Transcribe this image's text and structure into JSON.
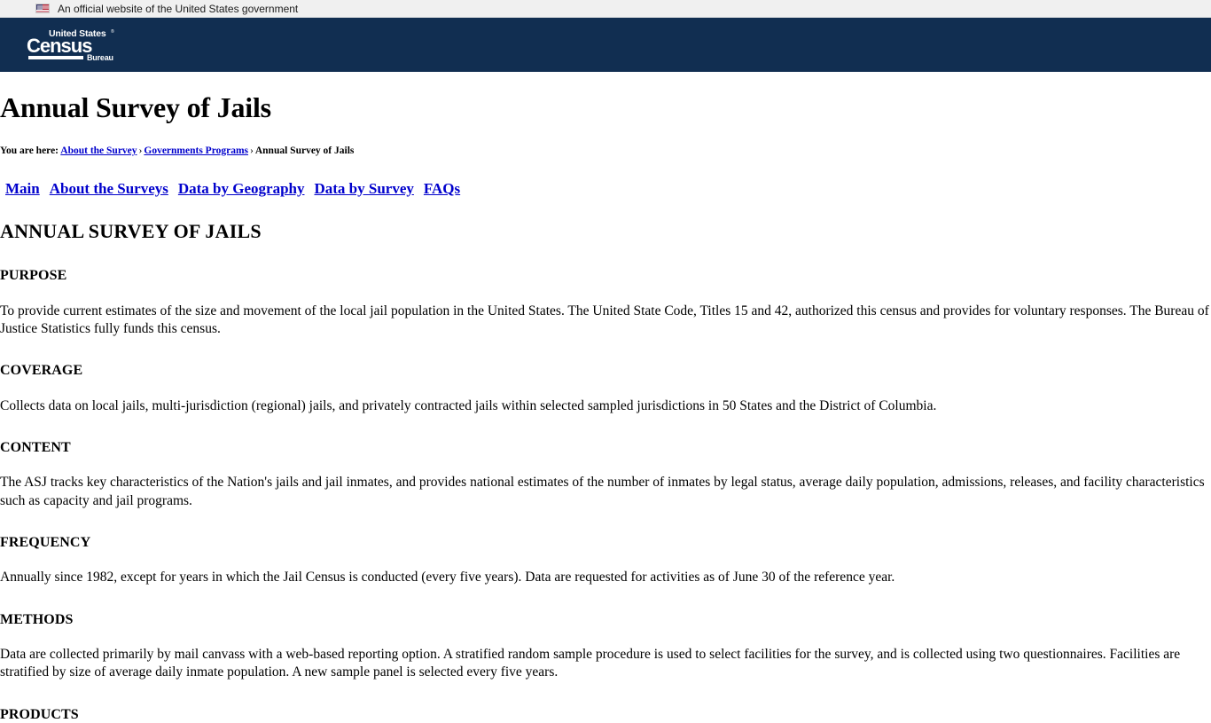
{
  "gov_banner": {
    "icon": "us-flag-icon",
    "text": "An official website of the United States government"
  },
  "header": {
    "logo": {
      "line1": "United States",
      "registered_mark": "®",
      "line2": "Census",
      "line3": "Bureau"
    },
    "background_color": "#112e51"
  },
  "page_title": "Annual Survey of Jails",
  "breadcrumb": {
    "prefix": "You are here:",
    "items": [
      {
        "label": "About the Survey",
        "is_link": true
      },
      {
        "label": "Governments Programs",
        "is_link": true
      },
      {
        "label": "Annual Survey of Jails",
        "is_link": false
      }
    ],
    "separator": "›"
  },
  "main_nav": {
    "items": [
      {
        "label": "Main"
      },
      {
        "label": "About the Surveys"
      },
      {
        "label": "Data by Geography"
      },
      {
        "label": "Data by Survey"
      },
      {
        "label": "FAQs"
      }
    ],
    "link_color": "#0000cc"
  },
  "content": {
    "heading": "ANNUAL SURVEY OF JAILS",
    "sections": [
      {
        "title": "PURPOSE",
        "text": "To provide current estimates of the size and movement of the local jail population in the United States. The United State Code, Titles 15 and 42, authorized this census and provides for voluntary responses. The Bureau of Justice Statistics fully funds this census."
      },
      {
        "title": "COVERAGE",
        "text": "Collects data on local jails, multi-jurisdiction (regional) jails, and privately contracted jails within selected sampled jurisdictions in 50 States and the District of Columbia."
      },
      {
        "title": "CONTENT",
        "text": "The ASJ tracks key characteristics of the Nation's jails and jail inmates, and provides national estimates of the number of inmates by legal status, average daily population, admissions, releases, and facility characteristics such as capacity and jail programs."
      },
      {
        "title": "FREQUENCY",
        "text": "Annually since 1982, except for years in which the Jail Census is conducted (every five years). Data are requested for activities as of June 30 of the reference year."
      },
      {
        "title": "METHODS",
        "text": "Data are collected primarily by mail canvass with a web-based reporting option. A stratified random sample procedure is used to select facilities for the survey, and is collected using two questionnaires. Facilities are stratified by size of average daily inmate population. A new sample panel is selected every five years."
      },
      {
        "title": "PRODUCTS",
        "text": ""
      }
    ]
  }
}
